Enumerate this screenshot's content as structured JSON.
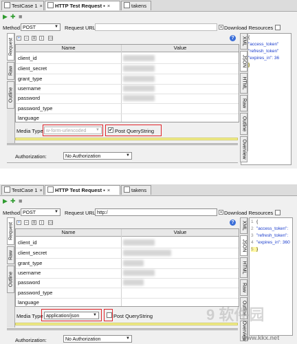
{
  "tabs": [
    {
      "label": "TestCase 1"
    },
    {
      "label": "HTTP Test Request",
      "suffix": "▪"
    },
    {
      "label": "takens"
    }
  ],
  "close_glyph": "×",
  "toolbar_icons": [
    "run-icon",
    "add-step-icon",
    "stop-icon"
  ],
  "method": {
    "label": "Method",
    "value": "POST"
  },
  "request_url": {
    "label": "Request URL:",
    "value_bottom": "http:/"
  },
  "download_resources": {
    "label": "Download Resources"
  },
  "grid": {
    "headers": {
      "name": "Name",
      "value": "Value"
    },
    "rows": [
      "client_id",
      "client_secret",
      "grant_type",
      "username",
      "password",
      "password_type",
      "language"
    ]
  },
  "left_tabs": [
    "Request",
    "Raw",
    "Outline"
  ],
  "right_tabs": [
    "XML",
    "JSON",
    "HTML",
    "Raw",
    "Outline",
    "Overview"
  ],
  "top_panel": {
    "media_type_label": "Media Type",
    "media_type_value": "w-form-urlencoded",
    "post_querystring": "Post QueryString",
    "post_querystring_checked": "✔"
  },
  "bottom_panel": {
    "media_type_label": "Media Type",
    "media_type_value": "application/json",
    "post_querystring": "Post QueryString"
  },
  "authorization": {
    "label": "Authorization:",
    "value": "No Authorization"
  },
  "help": "?",
  "json_lines": [
    {
      "n": "1",
      "t": "{"
    },
    {
      "n": "2",
      "k": "\"access_token\""
    },
    {
      "n": "3",
      "k": "\"refresh_token\""
    },
    {
      "n": "4",
      "k": "\"expires_in\": 36"
    },
    {
      "n": "5",
      "t": "}"
    }
  ],
  "json_lines_bottom": [
    {
      "n": "1",
      "t": "{"
    },
    {
      "n": "2",
      "k": "\"access_token\":"
    },
    {
      "n": "3",
      "k": "\"refresh_token\":"
    },
    {
      "n": "4",
      "k": "\"expires_in\": 360"
    },
    {
      "n": "5",
      "t": "}"
    }
  ],
  "watermark": {
    "site": "www.kkx.net",
    "brand": "9 软件园"
  },
  "colors": {
    "highlight_box": "#e0242a",
    "progress_bar": "#f4f08a",
    "json_key": "#1a3ccc"
  }
}
